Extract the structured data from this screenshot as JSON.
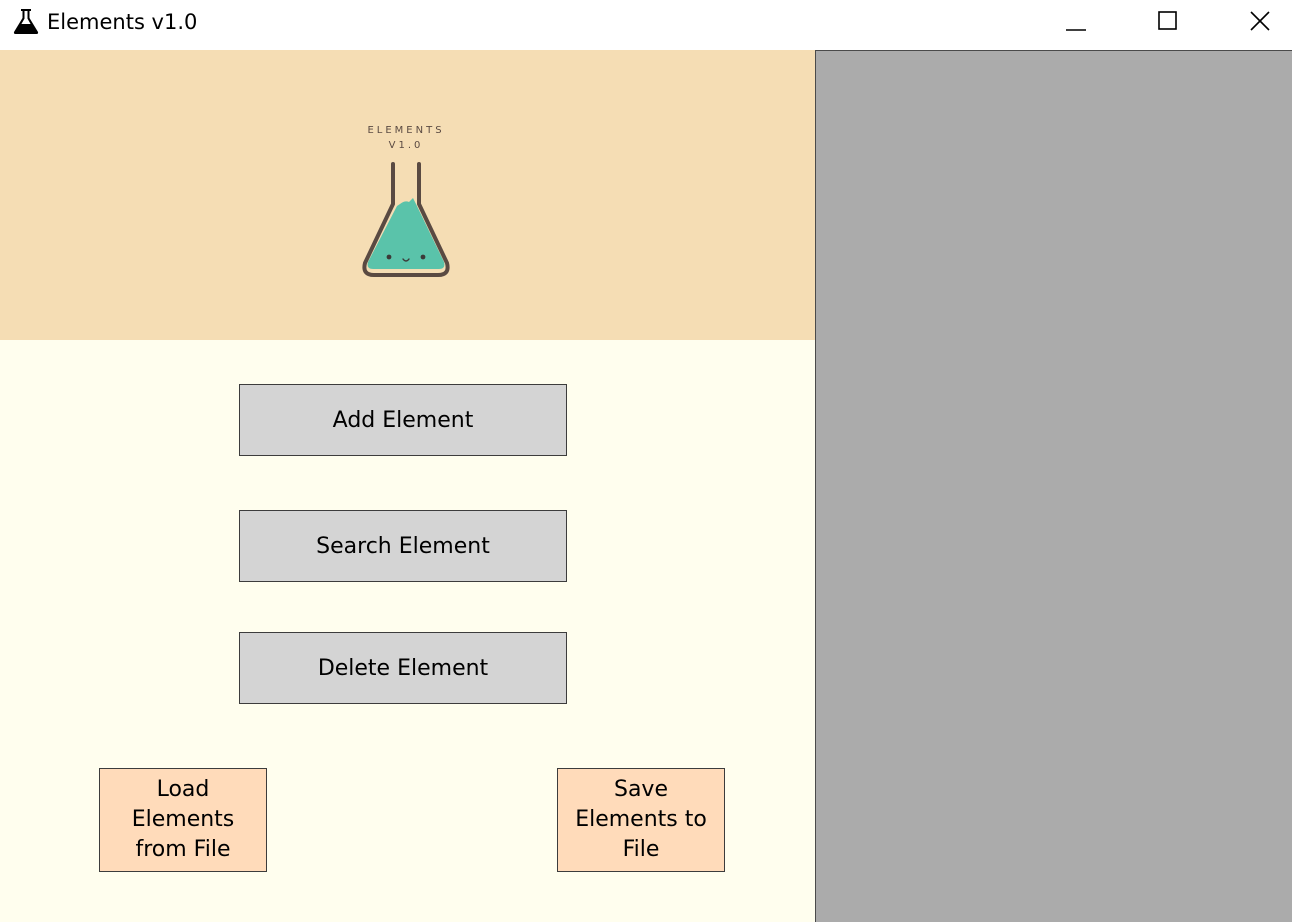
{
  "window": {
    "title": "Elements v1.0",
    "app_icon": "flask-icon",
    "controls": {
      "minimize_icon": "minimize-icon",
      "maximize_icon": "maximize-icon",
      "close_icon": "close-icon"
    }
  },
  "banner": {
    "logo_line1": "ELEMENTS",
    "logo_line2": "V1.0",
    "logo_icon": "flask-logo-icon"
  },
  "actions": {
    "add_label": "Add Element",
    "search_label": "Search Element",
    "delete_label": "Delete Element",
    "load_label": "Load\nElements\nfrom File",
    "save_label": "Save\nElements to\nFile"
  },
  "colors": {
    "banner_bg": "#f5ddb4",
    "panel_bg": "#fffeee",
    "button_bg": "#d4d4d4",
    "file_button_bg": "#ffdbba",
    "right_panel_bg": "#ababab",
    "flask_liquid": "#5ac3aa",
    "flask_outline": "#5a4a42"
  }
}
